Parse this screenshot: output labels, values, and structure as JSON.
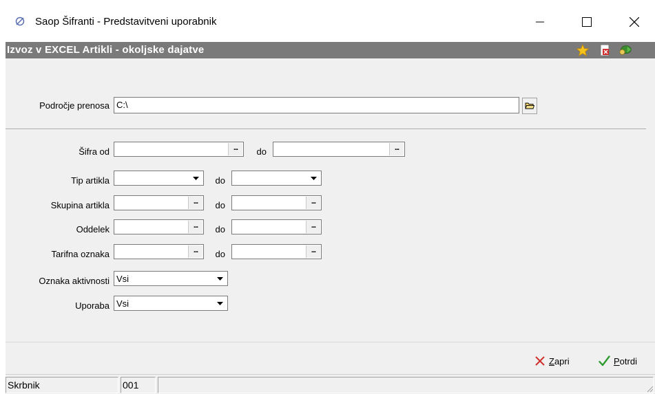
{
  "window": {
    "title": "Saop Šifranti - Predstavitveni uporabnik",
    "controls": [
      "minimize",
      "maximize",
      "close"
    ]
  },
  "form": {
    "title": "Izvoz v EXCEL Artikli - okoljske dajatve",
    "toolbar_icons": [
      "star-icon",
      "close-document-icon",
      "run-icon"
    ]
  },
  "transfer": {
    "label": "Področje prenosa",
    "value": "C:\\"
  },
  "range_fields": {
    "to_label": "do",
    "sifra": {
      "label": "Šifra od",
      "from": "",
      "to": ""
    },
    "tip": {
      "label": "Tip artikla",
      "from": "",
      "to": ""
    },
    "skupina": {
      "label": "Skupina artikla",
      "from": "",
      "to": ""
    },
    "oddelek": {
      "label": "Oddelek",
      "from": "",
      "to": ""
    },
    "tarifna": {
      "label": "Tarifna oznaka",
      "from": "",
      "to": ""
    }
  },
  "selects": {
    "aktivnost": {
      "label": "Oznaka aktivnosti",
      "value": "Vsi"
    },
    "uporaba": {
      "label": "Uporaba",
      "value": "Vsi"
    }
  },
  "buttons": {
    "close": {
      "mnemonic": "Z",
      "rest": "apri"
    },
    "confirm": {
      "mnemonic": "P",
      "rest": "otrdi"
    }
  },
  "status": {
    "user": "Skrbnik",
    "code": "001",
    "message": ""
  },
  "colors": {
    "header_bar": "#7a7a7a",
    "panel": "#f0f0f0",
    "close_x": "#d0312d",
    "confirm_check": "#2e9a2e"
  }
}
